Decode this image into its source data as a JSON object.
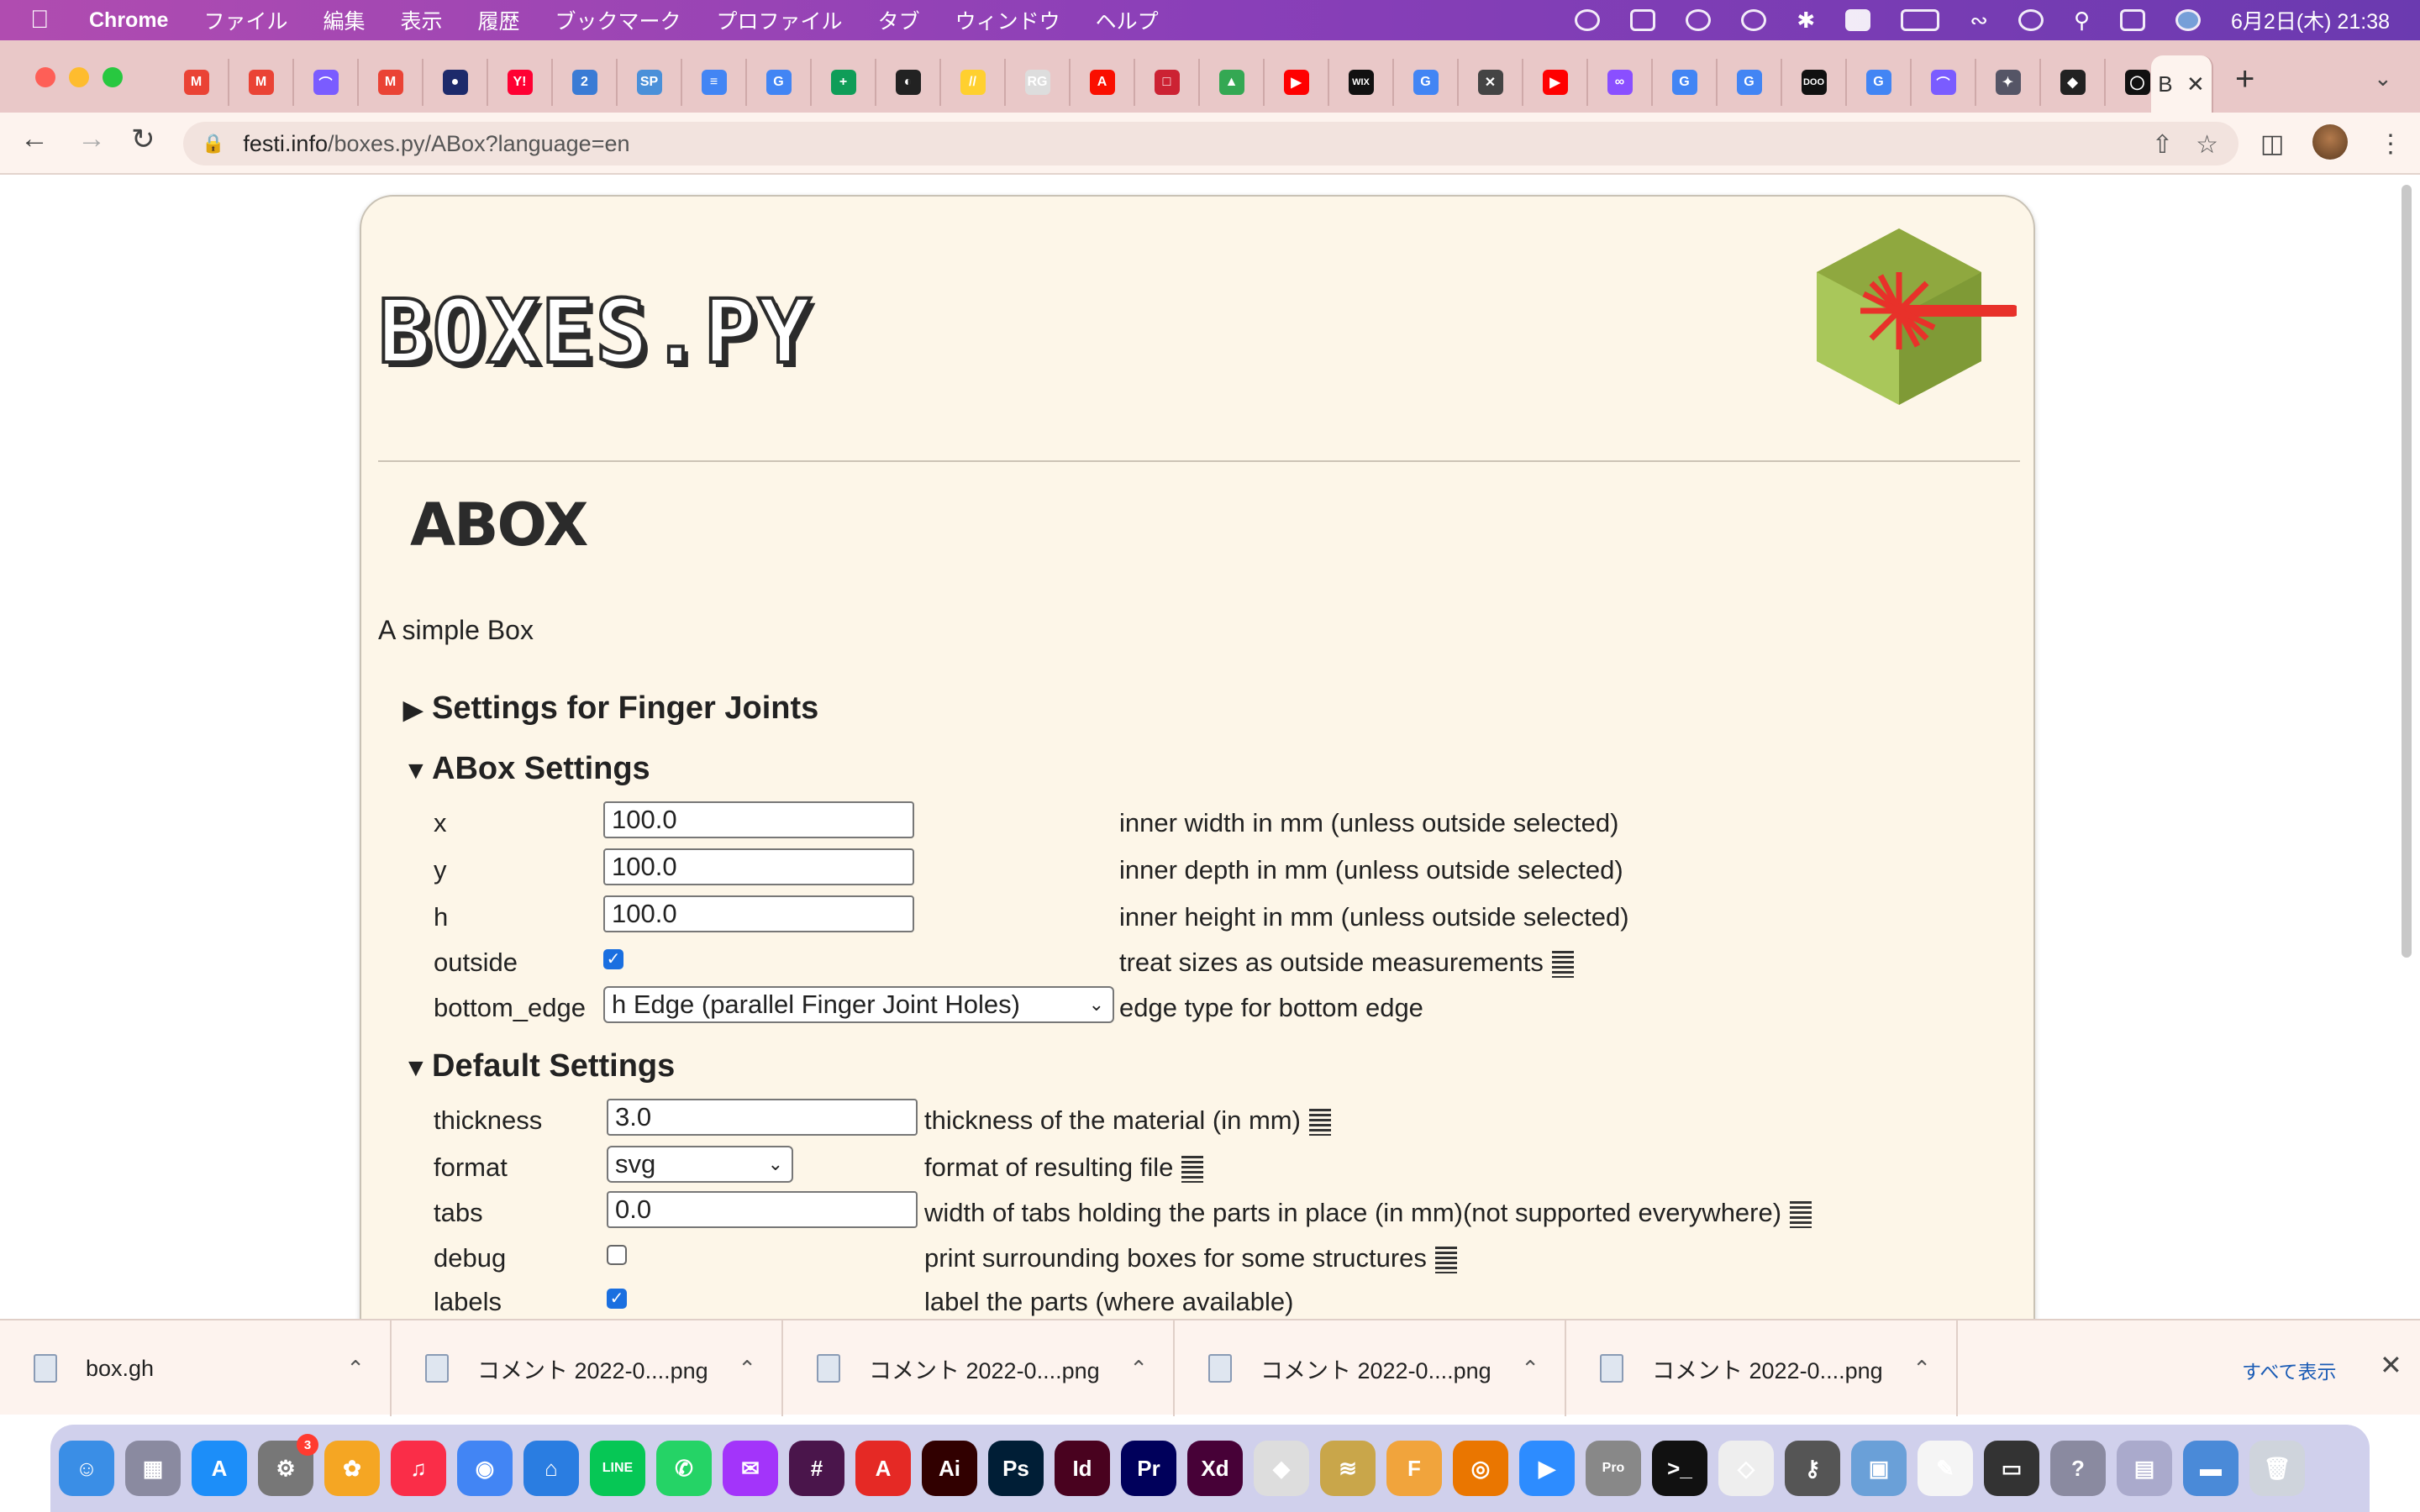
{
  "menubar": {
    "app_name": "Chrome",
    "items": [
      "ファイル",
      "編集",
      "表示",
      "履歴",
      "ブックマーク",
      "プロファイル",
      "タブ",
      "ウィンドウ",
      "ヘルプ"
    ],
    "clock": "6月2日(木) 21:38"
  },
  "tabs": {
    "favicons": [
      {
        "icon": "gmail-icon",
        "color": "#ea4335",
        "glyph": "M"
      },
      {
        "icon": "gmail-icon",
        "color": "#ea4335",
        "glyph": "M"
      },
      {
        "icon": "arc-icon",
        "color": "#7a5cff",
        "glyph": "⌒"
      },
      {
        "icon": "gmail-icon",
        "color": "#ea4335",
        "glyph": "M"
      },
      {
        "icon": "circle-logo-icon",
        "color": "#1d2a6b",
        "glyph": "●"
      },
      {
        "icon": "yahoo-icon",
        "color": "#ff0033",
        "glyph": "Y!"
      },
      {
        "icon": "calendar-icon",
        "color": "#3a7bd5",
        "glyph": "2"
      },
      {
        "icon": "sp-icon",
        "color": "#4a90d9",
        "glyph": "SP"
      },
      {
        "icon": "docs-icon",
        "color": "#4285f4",
        "glyph": "≡"
      },
      {
        "icon": "google-icon",
        "color": "#4285f4",
        "glyph": "G"
      },
      {
        "icon": "sheets-icon",
        "color": "#0f9d58",
        "glyph": "+"
      },
      {
        "icon": "dark-circle-icon",
        "color": "#222",
        "glyph": "◐"
      },
      {
        "icon": "miro-icon",
        "color": "#ffd02f",
        "glyph": "//"
      },
      {
        "icon": "rg-icon",
        "color": "#ddd",
        "glyph": "RG"
      },
      {
        "icon": "adobe-icon",
        "color": "#fa0f00",
        "glyph": "A"
      },
      {
        "icon": "book-icon",
        "color": "#c23",
        "glyph": "□"
      },
      {
        "icon": "drive-icon",
        "color": "#34a853",
        "glyph": "▲"
      },
      {
        "icon": "youtube-icon",
        "color": "#ff0000",
        "glyph": "▶"
      },
      {
        "icon": "wix-icon",
        "color": "#111",
        "glyph": "WIX"
      },
      {
        "icon": "google-icon",
        "color": "#4285f4",
        "glyph": "G"
      },
      {
        "icon": "tool-icon",
        "color": "#444",
        "glyph": "✕"
      },
      {
        "icon": "youtube-icon",
        "color": "#ff0000",
        "glyph": "▶"
      },
      {
        "icon": "loop-icon",
        "color": "#8a4fff",
        "glyph": "∞"
      },
      {
        "icon": "google-icon",
        "color": "#4285f4",
        "glyph": "G"
      },
      {
        "icon": "google-icon",
        "color": "#4285f4",
        "glyph": "G"
      },
      {
        "icon": "doo-icon",
        "color": "#111",
        "glyph": "DOO"
      },
      {
        "icon": "google-icon",
        "color": "#4285f4",
        "glyph": "G"
      },
      {
        "icon": "arc-icon",
        "color": "#7a5cff",
        "glyph": "⌒"
      },
      {
        "icon": "bird-icon",
        "color": "#556",
        "glyph": "✦"
      },
      {
        "icon": "rhino-icon",
        "color": "#222",
        "glyph": "◆"
      },
      {
        "icon": "github-icon",
        "color": "#111",
        "glyph": "◯"
      }
    ],
    "active_tab_glyph": "B",
    "close_glyph": "✕",
    "new_tab": "+"
  },
  "address": {
    "host": "festi.info",
    "path": "/boxes.py/ABox?language=en"
  },
  "page": {
    "logo_text": "BOXES.PY",
    "title": "ABOX",
    "description": "A simple Box",
    "sections": {
      "finger": {
        "marker": "▶",
        "title": "Settings for Finger Joints"
      },
      "abox": {
        "marker": "▼",
        "title": "ABox Settings"
      },
      "default": {
        "marker": "▼",
        "title": "Default Settings"
      }
    },
    "abox_fields": {
      "x": {
        "label": "x",
        "value": "100.0",
        "help": "inner width in mm (unless outside selected)"
      },
      "y": {
        "label": "y",
        "value": "100.0",
        "help": "inner depth in mm (unless outside selected)"
      },
      "h": {
        "label": "h",
        "value": "100.0",
        "help": "inner height in mm (unless outside selected)"
      },
      "outside": {
        "label": "outside",
        "checked": true,
        "help": "treat sizes as outside measurements"
      },
      "bottom_edge": {
        "label": "bottom_edge",
        "value": "h Edge (parallel Finger Joint Holes)",
        "help": "edge type for bottom edge"
      }
    },
    "default_fields": {
      "thickness": {
        "label": "thickness",
        "value": "3.0",
        "help": "thickness of the material (in mm)"
      },
      "format": {
        "label": "format",
        "value": "svg",
        "help": "format of resulting file"
      },
      "tabs": {
        "label": "tabs",
        "value": "0.0",
        "help": "width of tabs holding the parts in place (in mm)(not supported everywhere)"
      },
      "debug": {
        "label": "debug",
        "checked": false,
        "help": "print surrounding boxes for some structures"
      },
      "labels": {
        "label": "labels",
        "checked": true,
        "help": "label the parts (where available)"
      }
    }
  },
  "downloads": {
    "items": [
      "box.gh",
      "コメント 2022-0....png",
      "コメント 2022-0....png",
      "コメント 2022-0....png",
      "コメント 2022-0....png"
    ],
    "show_all": "すべて表示"
  },
  "dock": {
    "apps": [
      {
        "icon": "finder-icon",
        "color": "#3a8ee6",
        "glyph": "☺"
      },
      {
        "icon": "launchpad-icon",
        "color": "#8a8aa0",
        "glyph": "▦"
      },
      {
        "icon": "app-store-icon",
        "color": "#1c8ef9",
        "glyph": "A"
      },
      {
        "icon": "system-preferences-icon",
        "color": "#777",
        "glyph": "⚙",
        "badge": "3"
      },
      {
        "icon": "photos-icon",
        "color": "#f5a623",
        "glyph": "✿"
      },
      {
        "icon": "music-icon",
        "color": "#fa2d48",
        "glyph": "♫"
      },
      {
        "icon": "chrome-icon",
        "color": "#4285f4",
        "glyph": "◉"
      },
      {
        "icon": "keynote-icon",
        "color": "#2a7de1",
        "glyph": "⌂"
      },
      {
        "icon": "line-icon",
        "color": "#06c755",
        "glyph": "LINE"
      },
      {
        "icon": "whatsapp-icon",
        "color": "#25d366",
        "glyph": "✆"
      },
      {
        "icon": "messenger-icon",
        "color": "#a334fa",
        "glyph": "✉"
      },
      {
        "icon": "slack-icon",
        "color": "#4a154b",
        "glyph": "#"
      },
      {
        "icon": "acrobat-icon",
        "color": "#e52925",
        "glyph": "A"
      },
      {
        "icon": "illustrator-icon",
        "color": "#310000",
        "glyph": "Ai"
      },
      {
        "icon": "photoshop-icon",
        "color": "#001e36",
        "glyph": "Ps"
      },
      {
        "icon": "indesign-icon",
        "color": "#49021f",
        "glyph": "Id"
      },
      {
        "icon": "premiere-icon",
        "color": "#00005b",
        "glyph": "Pr"
      },
      {
        "icon": "xd-icon",
        "color": "#470137",
        "glyph": "Xd"
      },
      {
        "icon": "rhino-icon",
        "color": "#ddd",
        "glyph": "◆"
      },
      {
        "icon": "layers-icon",
        "color": "#c9a64a",
        "glyph": "≋"
      },
      {
        "icon": "fusion-icon",
        "color": "#f1a43c",
        "glyph": "F"
      },
      {
        "icon": "blender-icon",
        "color": "#ea7600",
        "glyph": "◎"
      },
      {
        "icon": "zoom-icon",
        "color": "#2d8cff",
        "glyph": "▶"
      },
      {
        "icon": "earth-pro-icon",
        "color": "#888",
        "glyph": "Pro"
      },
      {
        "icon": "terminal-icon",
        "color": "#111",
        "glyph": ">_"
      },
      {
        "icon": "sketchup-icon",
        "color": "#eee",
        "glyph": "◇"
      },
      {
        "icon": "keychain-icon",
        "color": "#555",
        "glyph": "⚷"
      },
      {
        "icon": "preview-icon",
        "color": "#6aa0d8",
        "glyph": "▣"
      },
      {
        "icon": "textedit-icon",
        "color": "#f5f5f5",
        "glyph": "✎"
      },
      {
        "icon": "screenshot-icon",
        "color": "#333",
        "glyph": "▭"
      },
      {
        "icon": "help-icon",
        "color": "#8a8aa0",
        "glyph": "?"
      },
      {
        "icon": "folder-thumbs-icon",
        "color": "#aac",
        "glyph": "▤"
      },
      {
        "icon": "display-icon",
        "color": "#4a8ad8",
        "glyph": "▬"
      },
      {
        "icon": "trash-icon",
        "color": "#cfd4dc",
        "glyph": "🗑"
      }
    ]
  }
}
